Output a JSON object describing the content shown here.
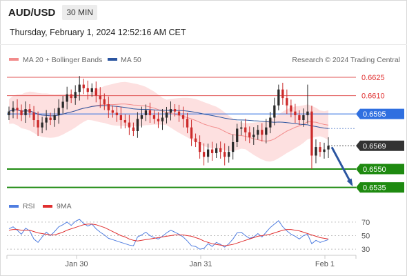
{
  "header": {
    "symbol": "AUD/USD",
    "timeframe": "30 MIN",
    "timestamp": "Thursday, February 1, 2024 12:52:16 AM CET"
  },
  "legend": {
    "ma20_label": "MA 20 + Bollinger Bands",
    "ma50_label": "MA 50",
    "credit": "Research © 2024 Trading Central",
    "rsi_label": "RSI",
    "rsi_ma_label": "9MA"
  },
  "chart_data": [
    {
      "type": "candlestick",
      "ylim": [
        0.6528,
        0.6634
      ],
      "x_ticks": [
        "Jan 30",
        "Jan 31",
        "Feb 1"
      ],
      "levels": [
        {
          "value": 0.6625,
          "label": "0.6625",
          "color": "#e05555",
          "kind": "resistance"
        },
        {
          "value": 0.661,
          "label": "0.6610",
          "color": "#e05555",
          "kind": "resistance"
        },
        {
          "value": 0.6595,
          "label": "0.6595",
          "color": "#2f6fe0",
          "kind": "pivot"
        },
        {
          "value": 0.6569,
          "label": "0.6569",
          "color": "#333333",
          "kind": "last-price"
        },
        {
          "value": 0.655,
          "label": "0.6550",
          "color": "#1e8a10",
          "kind": "support"
        },
        {
          "value": 0.6535,
          "label": "0.6535",
          "color": "#1e8a10",
          "kind": "support"
        }
      ],
      "forecast_arrow": {
        "from": 0.6569,
        "to": 0.6535
      },
      "closes": [
        0.6597,
        0.66,
        0.6598,
        0.6594,
        0.6599,
        0.6596,
        0.659,
        0.6584,
        0.6588,
        0.6592,
        0.659,
        0.6594,
        0.66,
        0.6605,
        0.6611,
        0.6608,
        0.6613,
        0.6619,
        0.6616,
        0.6613,
        0.6616,
        0.661,
        0.6607,
        0.6603,
        0.6598,
        0.6596,
        0.6594,
        0.659,
        0.6588,
        0.6584,
        0.6581,
        0.6591,
        0.6594,
        0.6598,
        0.6594,
        0.6591,
        0.6589,
        0.6592,
        0.6596,
        0.6599,
        0.6597,
        0.6594,
        0.6591,
        0.6584,
        0.6575,
        0.6572,
        0.6564,
        0.656,
        0.6566,
        0.6563,
        0.6567,
        0.6564,
        0.656,
        0.6564,
        0.6572,
        0.6583,
        0.6584,
        0.658,
        0.6576,
        0.6578,
        0.6582,
        0.6578,
        0.6584,
        0.6592,
        0.6602,
        0.6615,
        0.6608,
        0.6602,
        0.6597,
        0.6594,
        0.659,
        0.6594,
        0.6597,
        0.6561,
        0.6568,
        0.6564,
        0.6566,
        0.6569
      ]
    },
    {
      "type": "line",
      "title": "RSI",
      "ylim": [
        25,
        80
      ],
      "y_ticks": [
        70,
        50,
        30
      ],
      "series": [
        {
          "name": "RSI",
          "color": "#4f7de0",
          "values": [
            60,
            63,
            58,
            52,
            61,
            57,
            45,
            40,
            48,
            55,
            50,
            56,
            63,
            66,
            70,
            65,
            71,
            74,
            68,
            64,
            67,
            60,
            55,
            51,
            46,
            44,
            42,
            40,
            38,
            36,
            35,
            48,
            51,
            55,
            50,
            47,
            45,
            49,
            54,
            58,
            55,
            52,
            48,
            42,
            35,
            34,
            30,
            31,
            38,
            34,
            40,
            37,
            33,
            38,
            45,
            54,
            55,
            50,
            46,
            48,
            53,
            48,
            55,
            62,
            67,
            72,
            63,
            57,
            52,
            49,
            45,
            50,
            52,
            38,
            43,
            40,
            42,
            44
          ]
        },
        {
          "name": "9MA",
          "color": "#e03030",
          "values": [
            58,
            59,
            59,
            58,
            58,
            58,
            56,
            54,
            53,
            52,
            51,
            51,
            53,
            55,
            58,
            60,
            62,
            64,
            66,
            67,
            67,
            66,
            64,
            62,
            59,
            56,
            53,
            50,
            48,
            45,
            43,
            42,
            43,
            44,
            45,
            46,
            47,
            48,
            49,
            50,
            51,
            51,
            51,
            50,
            49,
            47,
            45,
            42,
            40,
            38,
            37,
            36,
            35,
            36,
            37,
            39,
            41,
            43,
            45,
            47,
            49,
            50,
            51,
            52,
            54,
            56,
            58,
            59,
            59,
            58,
            57,
            55,
            53,
            51,
            49,
            47,
            46,
            45
          ]
        }
      ]
    }
  ]
}
